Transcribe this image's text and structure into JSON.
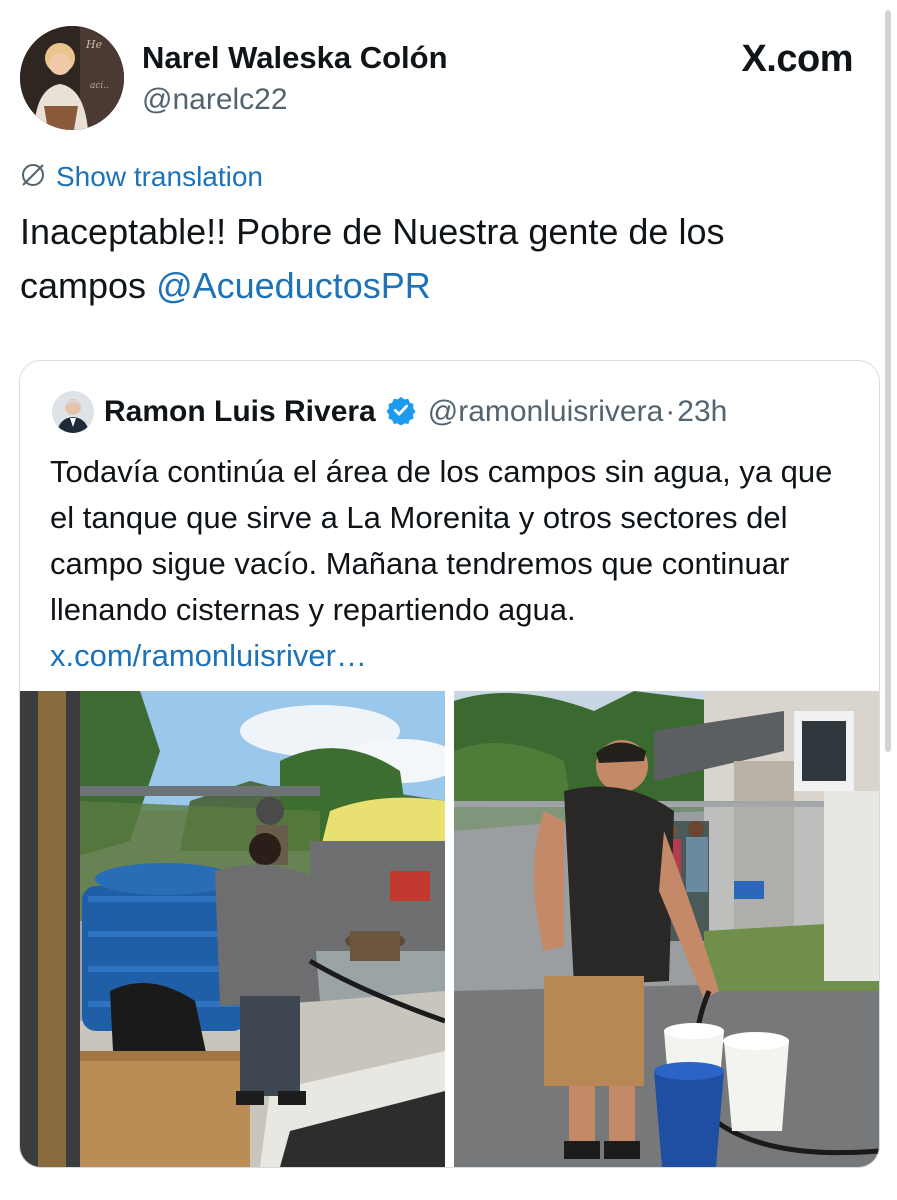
{
  "author": {
    "name": "Narel Waleska Colón",
    "handle": "@narelc22"
  },
  "brand": "X.com",
  "translation": {
    "label": "Show translation",
    "icon": "globe-slash-icon"
  },
  "tweet": {
    "text_part1": "Inaceptable!! Pobre de Nuestra gente de los campos ",
    "mention": "@AcueductosPR"
  },
  "quoted": {
    "name": "Ramon Luis Rivera",
    "handle": "@ramonluisrivera",
    "separator": "·",
    "time": "23h",
    "text": "Todavía continúa el área de los campos sin agua, ya que el tanque que sirve a La Morenita y otros sectores del campo sigue vacío. Mañana tendremos que continuar llenando cisternas y repartiendo agua. ",
    "link": "x.com/ramonluisriver…",
    "verified_icon": "verified-badge-icon"
  },
  "colors": {
    "link": "#1d72b8",
    "verified": "#1d9bf0",
    "secondary_text": "#536471"
  }
}
